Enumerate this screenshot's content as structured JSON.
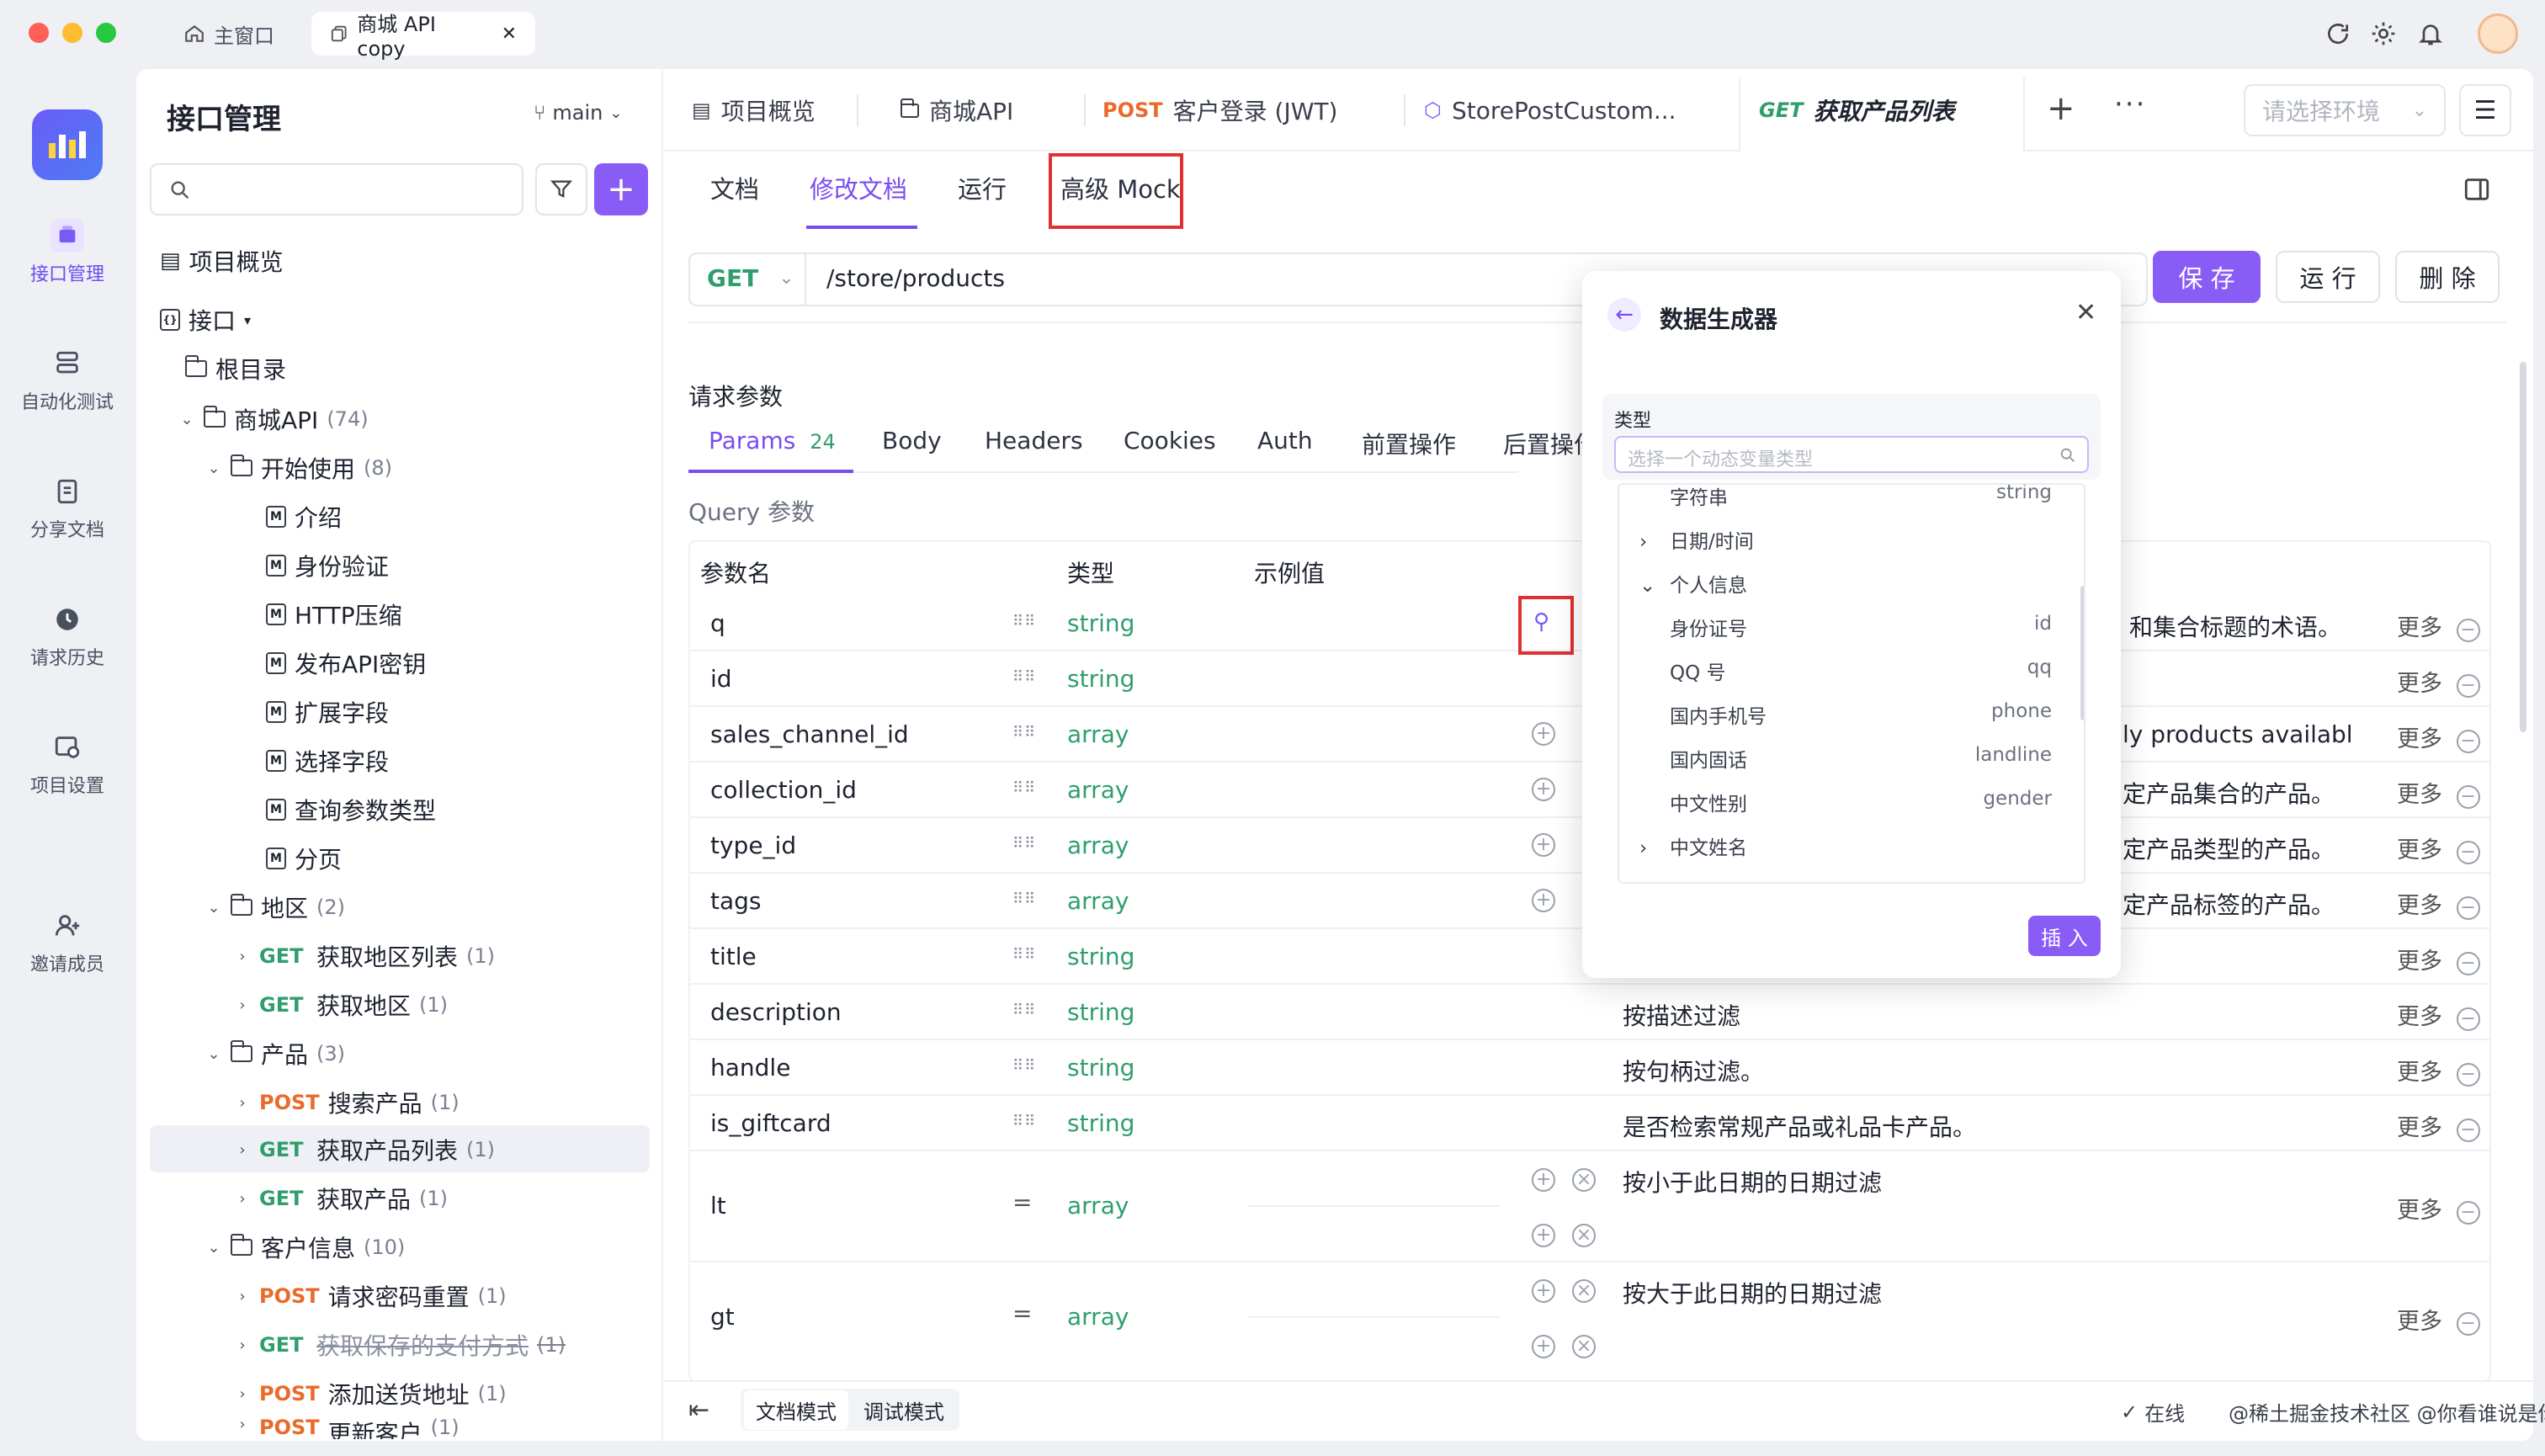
{
  "window_tabs": [
    {
      "label": "主窗口",
      "icon": "home-icon"
    },
    {
      "label": "商城 API copy",
      "icon": "copy-icon"
    }
  ],
  "rail": [
    {
      "label": "接口管理",
      "active": true,
      "icon": "api-icon"
    },
    {
      "label": "自动化测试",
      "icon": "automation-icon"
    },
    {
      "label": "分享文档",
      "icon": "share-doc-icon"
    },
    {
      "label": "请求历史",
      "icon": "history-icon"
    },
    {
      "label": "项目设置",
      "icon": "settings-icon"
    },
    {
      "label": "邀请成员",
      "icon": "invite-icon"
    }
  ],
  "tree_panel": {
    "title": "接口管理",
    "branch": "main",
    "search_placeholder": ""
  },
  "tree": [
    {
      "text": "项目概览"
    },
    {
      "text": "接口"
    },
    {
      "text": "根目录"
    },
    {
      "text": "商城API",
      "count": "(74)"
    },
    {
      "text": "开始使用",
      "count": "(8)"
    },
    {
      "text": "介绍"
    },
    {
      "text": "身份验证"
    },
    {
      "text": "HTTP压缩"
    },
    {
      "text": "发布API密钥"
    },
    {
      "text": "扩展字段"
    },
    {
      "text": "选择字段"
    },
    {
      "text": "查询参数类型"
    },
    {
      "text": "分页"
    },
    {
      "text": "地区",
      "count": "(2)"
    },
    {
      "method": "GET",
      "text": "获取地区列表",
      "count": "(1)"
    },
    {
      "method": "GET",
      "text": "获取地区",
      "count": "(1)"
    },
    {
      "text": "产品",
      "count": "(3)"
    },
    {
      "method": "POST",
      "text": "搜索产品",
      "count": "(1)"
    },
    {
      "method": "GET",
      "text": "获取产品列表",
      "count": "(1)"
    },
    {
      "method": "GET",
      "text": "获取产品",
      "count": "(1)"
    },
    {
      "text": "客户信息",
      "count": "(10)"
    },
    {
      "method": "POST",
      "text": "请求密码重置",
      "count": "(1)"
    },
    {
      "method": "GET",
      "text": "获取保存的支付方式",
      "count": "(1)"
    },
    {
      "method": "POST",
      "text": "添加送货地址",
      "count": "(1)"
    },
    {
      "method": "POST",
      "text": "更新客户",
      "count": "(1)"
    }
  ],
  "top_tabs": [
    {
      "label": "项目概览",
      "icon": "overview-icon"
    },
    {
      "label": "商城API",
      "icon": "folder-icon"
    },
    {
      "method": "POST",
      "label": "客户登录 (JWT)"
    },
    {
      "label": "StorePostCustom...",
      "icon": "cube-icon"
    },
    {
      "method": "GET",
      "label": "获取产品列表"
    }
  ],
  "env_placeholder": "请选择环境",
  "sub_tabs": [
    "文档",
    "修改文档",
    "运行",
    "高级 Mock"
  ],
  "request": {
    "method": "GET",
    "url": "/store/products",
    "save": "保 存",
    "run": "运 行",
    "delete": "删 除"
  },
  "params_section": {
    "title": "请求参数",
    "query_title": "Query 参数",
    "tabs": [
      {
        "label": "Params",
        "count": "24"
      },
      {
        "label": "Body"
      },
      {
        "label": "Headers"
      },
      {
        "label": "Cookies"
      },
      {
        "label": "Auth"
      },
      {
        "label": "前置操作"
      },
      {
        "label": "后置操作"
      }
    ],
    "headers": [
      "参数名",
      "类型",
      "示例值"
    ]
  },
  "params": [
    {
      "name": "q",
      "type": "string",
      "desc": "和集合标题的术语。",
      "more": "更多"
    },
    {
      "name": "id",
      "type": "string",
      "desc": "",
      "more": "更多"
    },
    {
      "name": "sales_channel_id",
      "type": "array",
      "desc": "ly products availabl",
      "more": "更多"
    },
    {
      "name": "collection_id",
      "type": "array",
      "desc": "定产品集合的产品。",
      "more": "更多"
    },
    {
      "name": "type_id",
      "type": "array",
      "desc": "定产品类型的产品。",
      "more": "更多"
    },
    {
      "name": "tags",
      "type": "array",
      "desc": "定产品标签的产品。",
      "more": "更多"
    },
    {
      "name": "title",
      "type": "string",
      "desc": "",
      "more": "更多"
    },
    {
      "name": "description",
      "type": "string",
      "desc": "按描述过滤",
      "more": "更多"
    },
    {
      "name": "handle",
      "type": "string",
      "desc": "按句柄过滤。",
      "more": "更多"
    },
    {
      "name": "is_giftcard",
      "type": "string",
      "desc": "是否检索常规产品或礼品卡产品。",
      "more": "更多"
    },
    {
      "name": "lt",
      "type": "array",
      "desc": "按小于此日期的日期过滤",
      "more": "更多"
    },
    {
      "name": "gt",
      "type": "array",
      "desc": "按大于此日期的日期过滤",
      "more": "更多"
    }
  ],
  "generator": {
    "title": "数据生成器",
    "type_label": "类型",
    "search_placeholder": "选择一个动态变量类型",
    "insert": "插 入",
    "items": [
      {
        "label": "字符串",
        "value": "string"
      },
      {
        "label": "日期/时间",
        "value": "",
        "expand": "›"
      },
      {
        "label": "个人信息",
        "value": "",
        "expand": "⌄"
      },
      {
        "label": "身份证号",
        "value": "id"
      },
      {
        "label": "QQ 号",
        "value": "qq"
      },
      {
        "label": "国内手机号",
        "value": "phone"
      },
      {
        "label": "国内固话",
        "value": "landline"
      },
      {
        "label": "中文性别",
        "value": "gender"
      },
      {
        "label": "中文姓名",
        "value": "",
        "expand": "›"
      }
    ]
  },
  "footer": {
    "doc_mode": "文档模式",
    "debug_mode": "调试模式",
    "online": "在线",
    "watermark": "@稀土掘金技术社区 @你看谁说是你"
  },
  "colors": {
    "accent": "#8a5cf6",
    "get": "#2f9e6d",
    "post": "#ea6a2a",
    "highlight": "#e03131"
  }
}
